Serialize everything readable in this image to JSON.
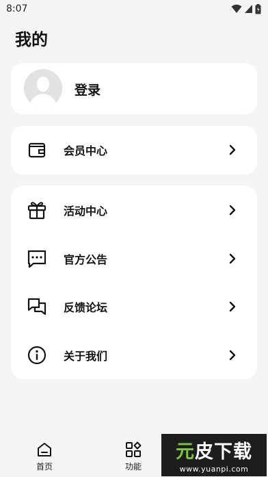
{
  "status_bar": {
    "time": "8:07"
  },
  "page_title": "我的",
  "profile": {
    "login_label": "登录"
  },
  "member": {
    "label": "会员中心"
  },
  "menu": {
    "items": [
      {
        "label": "活动中心",
        "icon": "gift-icon"
      },
      {
        "label": "官方公告",
        "icon": "message-icon"
      },
      {
        "label": "反馈论坛",
        "icon": "chat-bubbles-icon"
      },
      {
        "label": "关于我们",
        "icon": "info-icon"
      }
    ]
  },
  "bottom_nav": {
    "items": [
      {
        "label": "首页",
        "icon": "home-icon"
      },
      {
        "label": "功能",
        "icon": "apps-grid-icon"
      }
    ]
  },
  "watermark": {
    "title_a": "元",
    "title_b": "皮下载",
    "url": "www.yuanpi.com"
  }
}
